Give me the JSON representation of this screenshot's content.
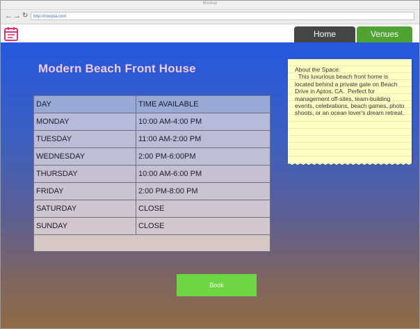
{
  "window": {
    "title": "Mockup"
  },
  "browser": {
    "url": "http://mxopia.com",
    "back_icon": "arrow-left-icon",
    "forward_icon": "arrow-right-icon",
    "reload_icon": "reload-icon"
  },
  "app": {
    "icon": "calendar-icon",
    "accent": "#e0306f"
  },
  "tabs": [
    {
      "label": "Home",
      "color": "#454545"
    },
    {
      "label": "Venues",
      "color": "#4ea332"
    }
  ],
  "page": {
    "title": "Modern Beach Front House"
  },
  "schedule": {
    "headers": [
      "DAY",
      "TIME AVAILABLE"
    ],
    "rows": [
      [
        "MONDAY",
        "10:00 AM-4:00 PM"
      ],
      [
        "TUESDAY",
        "11:00 AM-2:00 PM"
      ],
      [
        "WEDNESDAY",
        "2:00 PM-6:00PM"
      ],
      [
        "THURSDAY",
        "10:00 AM-6:00 PM"
      ],
      [
        "FRIDAY",
        "2:00 PM-8:00 PM"
      ],
      [
        "SATURDAY",
        "CLOSE"
      ],
      [
        "SUNDAY",
        "CLOSE"
      ]
    ]
  },
  "note": {
    "text": "About the Space:\n  This luxurious beach front home is located behind a private gate on Beach Drive in Aptos, CA.  Perfect for management off-sites, team-building events, celebrations, beach games, photo shoots, or an ocean lover's dream retreat."
  },
  "book_button": {
    "label": "Book",
    "color": "#6fd643"
  }
}
